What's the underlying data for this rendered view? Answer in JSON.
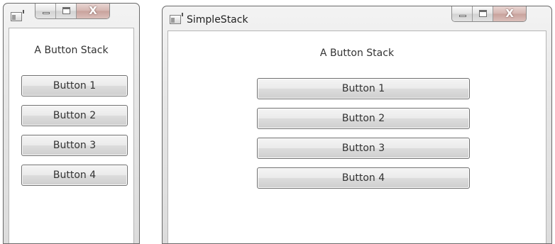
{
  "small_window": {
    "title": "",
    "label": "A Button Stack",
    "buttons": [
      "Button 1",
      "Button 2",
      "Button 3",
      "Button 4"
    ]
  },
  "large_window": {
    "title": "SimpleStack",
    "label": "A Button Stack",
    "buttons": [
      "Button 1",
      "Button 2",
      "Button 3",
      "Button 4"
    ]
  },
  "caption_buttons": {
    "close_glyph": "X"
  },
  "icons": {
    "app": "window-app-icon",
    "minimize": "minimize-icon",
    "maximize": "maximize-icon",
    "close": "close-icon"
  },
  "colors": {
    "close_button": "#cfa9a3",
    "window_frame": "#e4e4e4",
    "client_background": "#ffffff",
    "text": "#333333"
  }
}
